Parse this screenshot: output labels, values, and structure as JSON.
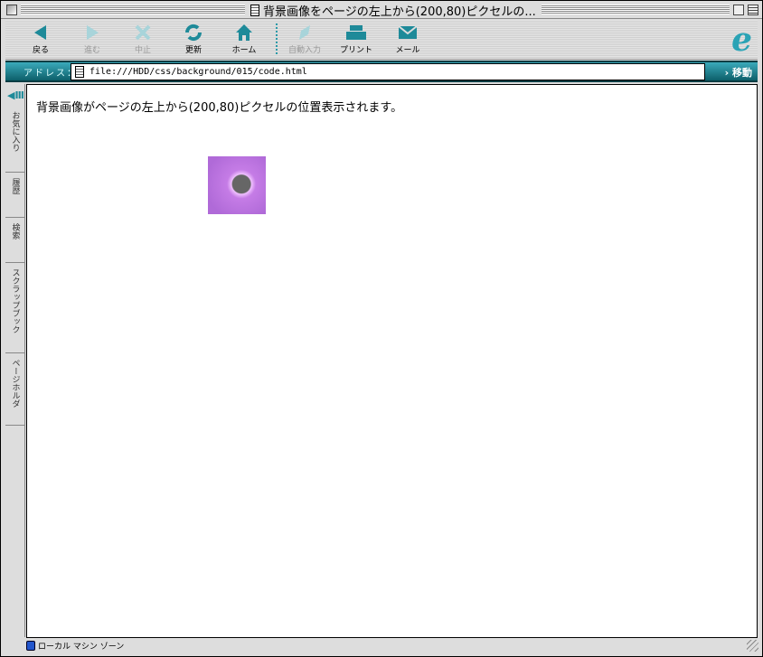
{
  "window": {
    "title": "背景画像をページの左上から(200,80)ピクセルの..."
  },
  "toolbar": {
    "buttons": [
      {
        "label": "戻る",
        "icon": "back-arrow-icon",
        "enabled": true
      },
      {
        "label": "進む",
        "icon": "forward-arrow-icon",
        "enabled": false
      },
      {
        "label": "中止",
        "icon": "stop-icon",
        "enabled": false
      },
      {
        "label": "更新",
        "icon": "refresh-icon",
        "enabled": true
      },
      {
        "label": "ホーム",
        "icon": "home-icon",
        "enabled": true
      },
      {
        "label": "自動入力",
        "icon": "autofill-icon",
        "enabled": false
      },
      {
        "label": "プリント",
        "icon": "print-icon",
        "enabled": true
      },
      {
        "label": "メール",
        "icon": "mail-icon",
        "enabled": true
      }
    ]
  },
  "address": {
    "label": "アドレス：",
    "url": "file:///HDD/css/background/015/code.html",
    "go_label": "移動"
  },
  "sidebar": {
    "tabs": [
      "お気に入り",
      "履歴",
      "検索",
      "スクラップブック",
      "ページホルダ"
    ]
  },
  "content": {
    "text": "背景画像がページの左上から(200,80)ピクセルの位置表示されます。"
  },
  "status": {
    "zone": "ローカル マシン ゾーン"
  },
  "colors": {
    "accent": "#1e8a99",
    "image": "#b06ad8"
  }
}
